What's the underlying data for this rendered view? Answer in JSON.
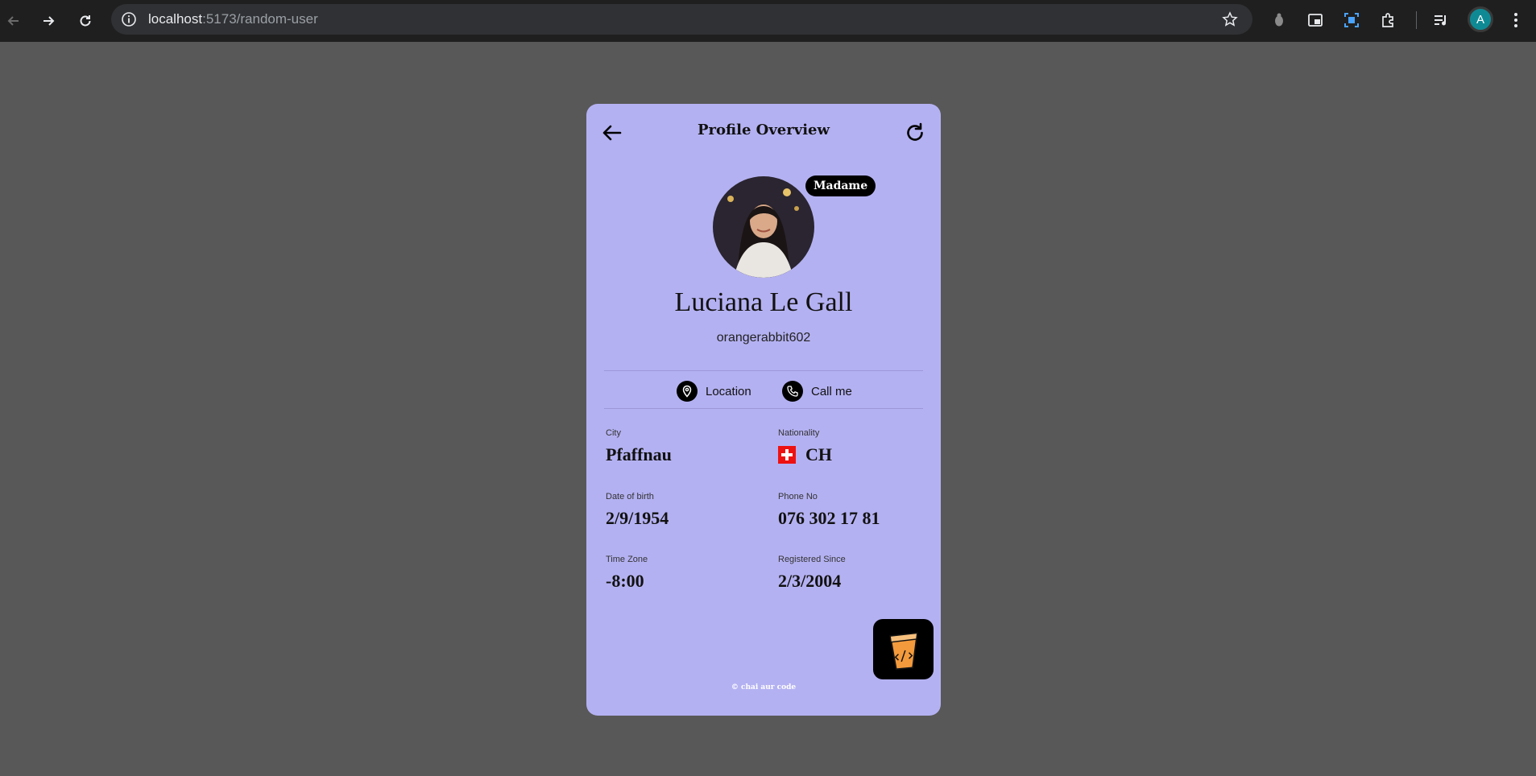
{
  "browser": {
    "url_host": "localhost",
    "url_path": ":5173/random-user",
    "profile_initial": "A"
  },
  "card": {
    "title": "Profile Overview",
    "title_badge": "Madame",
    "full_name": "Luciana Le Gall",
    "username": "orangerabbit602",
    "actions": {
      "location": "Location",
      "call": "Call me"
    },
    "fields": {
      "city": {
        "label": "City",
        "value": "Pfaffnau"
      },
      "nationality": {
        "label": "Nationality",
        "value": "CH"
      },
      "dob": {
        "label": "Date of birth",
        "value": "2/9/1954"
      },
      "phone": {
        "label": "Phone No",
        "value": "076 302 17 81"
      },
      "timezone": {
        "label": "Time Zone",
        "value": "-8:00"
      },
      "registered": {
        "label": "Registered Since",
        "value": "2/3/2004"
      }
    },
    "footer": "© chai aur code",
    "colors": {
      "card_bg": "#b4b1f2",
      "page_bg": "#585858",
      "logo_orange": "#f39a3c"
    }
  }
}
